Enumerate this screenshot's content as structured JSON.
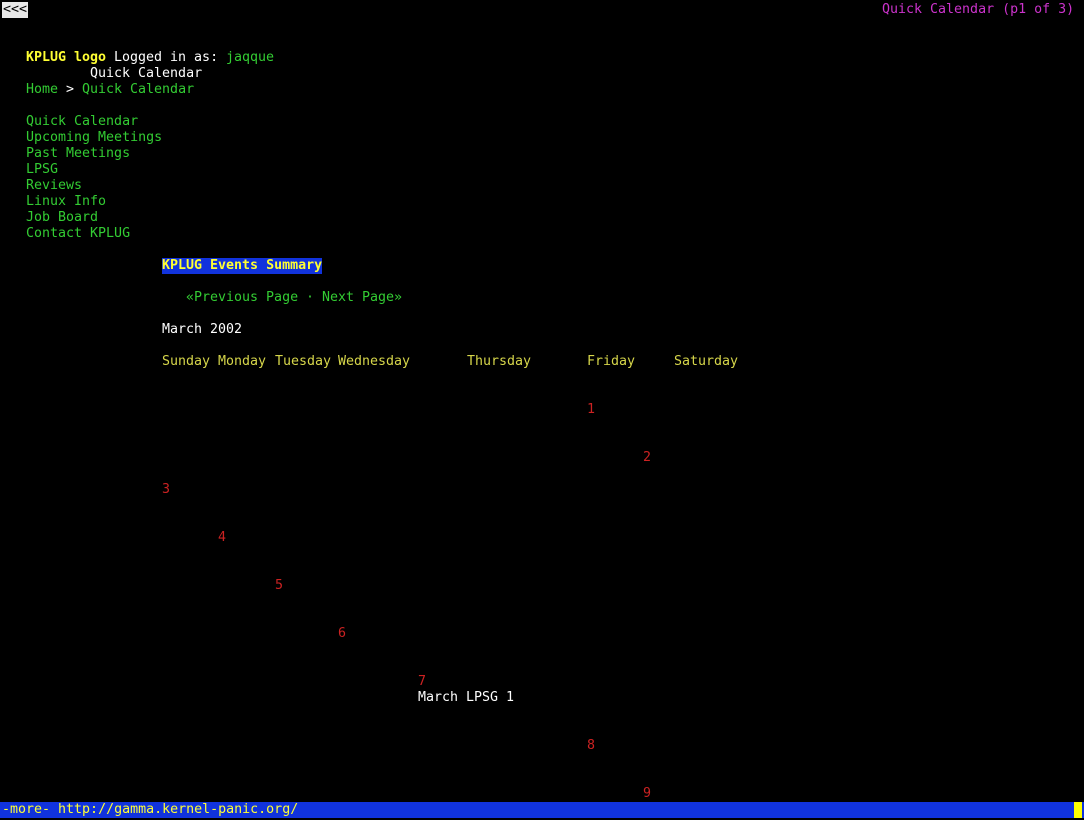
{
  "top_bar": {
    "back_label": "<<<",
    "page_status": "Quick Calendar (p1 of 3)"
  },
  "header": {
    "logo_text": "KPLUG logo",
    "logged_in_label": "Logged in as:",
    "username": "jaqque",
    "subtitle": "Quick Calendar"
  },
  "breadcrumb": {
    "home": "Home",
    "separator": ">",
    "current": "Quick Calendar"
  },
  "nav": {
    "items": [
      "Quick Calendar",
      "Upcoming Meetings",
      "Past Meetings",
      "LPSG",
      "Reviews",
      "Linux Info",
      "Job Board",
      "Contact KPLUG"
    ]
  },
  "events": {
    "title": "KPLUG Events Summary",
    "prev_page": "«Previous Page",
    "separator": "·",
    "next_page": "Next Page»",
    "month": "March 2002",
    "weekdays": [
      "Sunday",
      "Monday",
      "Tuesday",
      "Wednesday",
      "Thursday",
      "Friday",
      "Saturday"
    ],
    "days": [
      "1",
      "2",
      "3",
      "4",
      "5",
      "6",
      "7",
      "8",
      "9"
    ],
    "event_text": "March LPSG 1"
  },
  "status_bar": {
    "text": "-more- http://gamma.kernel-panic.org/"
  },
  "colors": {
    "background": "#000000",
    "link": "#33cc33",
    "heading": "#ffff33",
    "weekday": "#d6d64a",
    "day_number": "#cc2222",
    "status_bg": "#1133dd",
    "page_status": "#cc33cc"
  }
}
